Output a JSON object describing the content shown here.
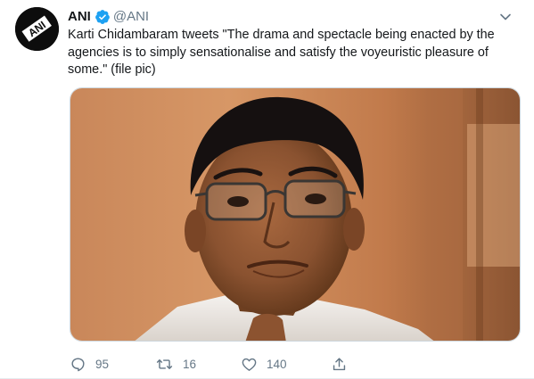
{
  "tweet": {
    "author": {
      "name": "ANI",
      "handle": "@ANI",
      "verified": true,
      "avatar_icon": "ani-logo-icon"
    },
    "text": "Karti Chidambaram tweets \"The drama and spectacle being enacted by the agencies is to simply sensationalise and satisfy the voyeuristic pleasure of some.\" (file pic)",
    "media": {
      "type": "photo"
    },
    "stats": {
      "replies": "95",
      "retweets": "16",
      "likes": "140"
    }
  },
  "icons": {
    "verified": "verified-badge-icon",
    "menu": "chevron-down-icon",
    "reply": "reply-icon",
    "retweet": "retweet-icon",
    "like": "heart-icon",
    "share": "share-icon"
  },
  "colors": {
    "accent": "#1da1f2",
    "text": "#14171a",
    "secondary": "#657786",
    "border": "#e6ecf0"
  }
}
